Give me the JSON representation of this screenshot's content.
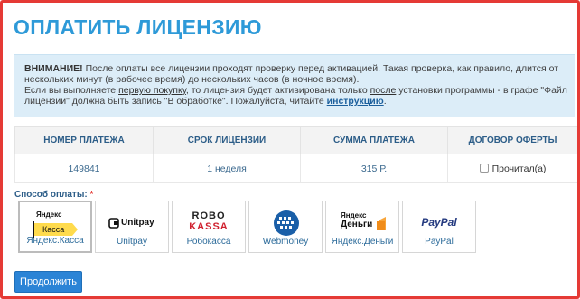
{
  "page_title": "ОПЛАТИТЬ ЛИЦЕНЗИЮ",
  "notice": {
    "warning_label": "ВНИМАНИЕ!",
    "line1": " После оплаты все лицензии проходят проверку перед активацией. Такая проверка, как правило, длится от нескольких минут (в рабочее время) до нескольких часов (в ночное время).",
    "line2_pre": "Если вы выполняете ",
    "first_purchase_link": "первую покупку",
    "line2_mid": ", то лицензия будет активирована только ",
    "after_link": "после",
    "line2_post": " установки программы - в графе \"Файл лицензии\" должна быть запись \"В обработке\". Пожалуйста, читайте ",
    "instruction_link": "инструкцию",
    "line2_end": "."
  },
  "table": {
    "headers": [
      "НОМЕР ПЛАТЕЖА",
      "СРОК ЛИЦЕНЗИИ",
      "СУММА ПЛАТЕЖА",
      "ДОГОВОР ОФЕРТЫ"
    ],
    "payment_number": "149841",
    "license_period": "1 неделя",
    "amount": "315 Р.",
    "offer_checkbox_label": "Прочитал(а)",
    "offer_checked": false
  },
  "payment": {
    "label": "Способ оплаты:",
    "required_mark": "*",
    "methods": [
      {
        "name": "Яндекс.Касса",
        "icon": "yandex-kassa-logo",
        "logo_top": "Яндекс",
        "logo_bottom": "Касса"
      },
      {
        "name": "Unitpay",
        "icon": "unitpay-logo",
        "logo_text": "Unitpay"
      },
      {
        "name": "Робокасса",
        "icon": "robokassa-logo",
        "logo_top": "ROBO",
        "logo_bottom": "KASSA"
      },
      {
        "name": "Webmoney",
        "icon": "webmoney-globe-icon"
      },
      {
        "name": "Яндекс.Деньги",
        "icon": "yandex-money-logo",
        "logo_top": "Яндекс",
        "logo_bottom": "Деньги"
      },
      {
        "name": "PayPal",
        "icon": "paypal-logo",
        "logo_text": "PayPal"
      }
    ]
  },
  "submit_label": "Продолжить",
  "colors": {
    "title": "#2e9ad8",
    "notice_bg": "#dcedf8",
    "frame_border": "#e53a35",
    "button": "#2b84d6"
  }
}
